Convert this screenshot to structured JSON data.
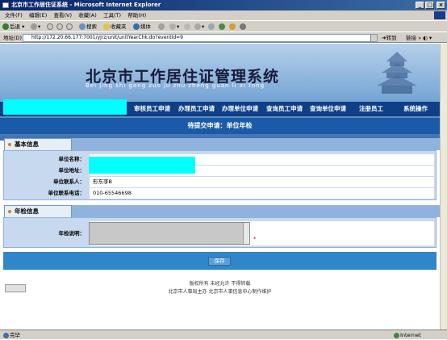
{
  "window": {
    "title": "北京市工作居住证系统 - Microsoft Internet Explorer",
    "buttons": [
      "_",
      "□",
      "×"
    ]
  },
  "menu": [
    "文件(F)",
    "编辑(E)",
    "查看(V)",
    "收藏(A)",
    "工具(T)",
    "帮助(H)"
  ],
  "toolbar": {
    "back": "后退",
    "search": "搜索",
    "favorites": "收藏夹",
    "media": "媒体"
  },
  "address": {
    "label": "地址(D)",
    "url": "http://172.20.66.177:7001/yjrz/unit/unitYearChk.do?eventId=9",
    "go": "转到",
    "links": "链接"
  },
  "banner": {
    "title": "北京市工作居住证管理系统",
    "pinyin": "Bei jing shi gong zuo ju zhu zheng guan li xi tong"
  },
  "nav": [
    "审核员工申请",
    "办理员工申请",
    "办理单位申请",
    "查询员工申请",
    "查询单位申请",
    "注册员工",
    "系统操作"
  ],
  "subtitle": "待提交申请：单位年检",
  "basic": {
    "header": "基本信息",
    "rows": [
      {
        "label": "单位名称：",
        "value": ""
      },
      {
        "label": "单位地址：",
        "value": ""
      },
      {
        "label": "单位联系人：",
        "value": "形东李B"
      },
      {
        "label": "单位联系电话：",
        "value": "010-65546698"
      }
    ]
  },
  "annual": {
    "header": "年检信息",
    "label": "年检说明：",
    "required_mark": "*"
  },
  "save_label": "保存",
  "footer": {
    "line1": "版权所有  未经允许  不得转载",
    "line2": "北京市人事局主办  北京市人事信息中心制作维护"
  },
  "status": {
    "left": "完毕",
    "right": "Internet"
  },
  "colors": {
    "nav_bg": "#0f3f86",
    "subtitle_bg": "#1b5aa6",
    "form_bg": "#c7d9ee",
    "redaction": "#00ffff"
  }
}
